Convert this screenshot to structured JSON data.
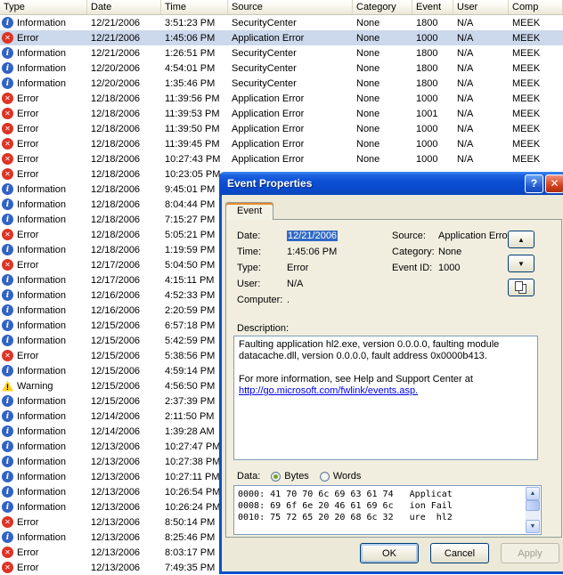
{
  "list": {
    "columns": [
      "Type",
      "Date",
      "Time",
      "Source",
      "Category",
      "Event",
      "User",
      "Comp"
    ],
    "rows": [
      {
        "type": "Information",
        "date": "12/21/2006",
        "time": "3:51:23 PM",
        "source": "SecurityCenter",
        "category": "None",
        "event": "1800",
        "user": "N/A",
        "computer": "MEEK",
        "selected": false
      },
      {
        "type": "Error",
        "date": "12/21/2006",
        "time": "1:45:06 PM",
        "source": "Application Error",
        "category": "None",
        "event": "1000",
        "user": "N/A",
        "computer": "MEEK",
        "selected": true
      },
      {
        "type": "Information",
        "date": "12/21/2006",
        "time": "1:26:51 PM",
        "source": "SecurityCenter",
        "category": "None",
        "event": "1800",
        "user": "N/A",
        "computer": "MEEK",
        "selected": false
      },
      {
        "type": "Information",
        "date": "12/20/2006",
        "time": "4:54:01 PM",
        "source": "SecurityCenter",
        "category": "None",
        "event": "1800",
        "user": "N/A",
        "computer": "MEEK",
        "selected": false
      },
      {
        "type": "Information",
        "date": "12/20/2006",
        "time": "1:35:46 PM",
        "source": "SecurityCenter",
        "category": "None",
        "event": "1800",
        "user": "N/A",
        "computer": "MEEK",
        "selected": false
      },
      {
        "type": "Error",
        "date": "12/18/2006",
        "time": "11:39:56 PM",
        "source": "Application Error",
        "category": "None",
        "event": "1000",
        "user": "N/A",
        "computer": "MEEK",
        "selected": false
      },
      {
        "type": "Error",
        "date": "12/18/2006",
        "time": "11:39:53 PM",
        "source": "Application Error",
        "category": "None",
        "event": "1001",
        "user": "N/A",
        "computer": "MEEK",
        "selected": false
      },
      {
        "type": "Error",
        "date": "12/18/2006",
        "time": "11:39:50 PM",
        "source": "Application Error",
        "category": "None",
        "event": "1000",
        "user": "N/A",
        "computer": "MEEK",
        "selected": false
      },
      {
        "type": "Error",
        "date": "12/18/2006",
        "time": "11:39:45 PM",
        "source": "Application Error",
        "category": "None",
        "event": "1000",
        "user": "N/A",
        "computer": "MEEK",
        "selected": false
      },
      {
        "type": "Error",
        "date": "12/18/2006",
        "time": "10:27:43 PM",
        "source": "Application Error",
        "category": "None",
        "event": "1000",
        "user": "N/A",
        "computer": "MEEK",
        "selected": false
      },
      {
        "type": "Error",
        "date": "12/18/2006",
        "time": "10:23:05 PM",
        "source": "",
        "category": "",
        "event": "",
        "user": "",
        "computer": "",
        "selected": false
      },
      {
        "type": "Information",
        "date": "12/18/2006",
        "time": "9:45:01 PM",
        "source": "",
        "category": "",
        "event": "",
        "user": "",
        "computer": "",
        "selected": false
      },
      {
        "type": "Information",
        "date": "12/18/2006",
        "time": "8:04:44 PM",
        "source": "",
        "category": "",
        "event": "",
        "user": "",
        "computer": "",
        "selected": false
      },
      {
        "type": "Information",
        "date": "12/18/2006",
        "time": "7:15:27 PM",
        "source": "",
        "category": "",
        "event": "",
        "user": "",
        "computer": "",
        "selected": false
      },
      {
        "type": "Error",
        "date": "12/18/2006",
        "time": "5:05:21 PM",
        "source": "",
        "category": "",
        "event": "",
        "user": "",
        "computer": "",
        "selected": false
      },
      {
        "type": "Information",
        "date": "12/18/2006",
        "time": "1:19:59 PM",
        "source": "",
        "category": "",
        "event": "",
        "user": "",
        "computer": "",
        "selected": false
      },
      {
        "type": "Error",
        "date": "12/17/2006",
        "time": "5:04:50 PM",
        "source": "",
        "category": "",
        "event": "",
        "user": "",
        "computer": "",
        "selected": false
      },
      {
        "type": "Information",
        "date": "12/17/2006",
        "time": "4:15:11 PM",
        "source": "",
        "category": "",
        "event": "",
        "user": "",
        "computer": "",
        "selected": false
      },
      {
        "type": "Information",
        "date": "12/16/2006",
        "time": "4:52:33 PM",
        "source": "",
        "category": "",
        "event": "",
        "user": "",
        "computer": "",
        "selected": false
      },
      {
        "type": "Information",
        "date": "12/16/2006",
        "time": "2:20:59 PM",
        "source": "",
        "category": "",
        "event": "",
        "user": "",
        "computer": "",
        "selected": false
      },
      {
        "type": "Information",
        "date": "12/15/2006",
        "time": "6:57:18 PM",
        "source": "",
        "category": "",
        "event": "",
        "user": "",
        "computer": "",
        "selected": false
      },
      {
        "type": "Information",
        "date": "12/15/2006",
        "time": "5:42:59 PM",
        "source": "",
        "category": "",
        "event": "",
        "user": "",
        "computer": "",
        "selected": false
      },
      {
        "type": "Error",
        "date": "12/15/2006",
        "time": "5:38:56 PM",
        "source": "",
        "category": "",
        "event": "",
        "user": "",
        "computer": "",
        "selected": false
      },
      {
        "type": "Information",
        "date": "12/15/2006",
        "time": "4:59:14 PM",
        "source": "",
        "category": "",
        "event": "",
        "user": "",
        "computer": "",
        "selected": false
      },
      {
        "type": "Warning",
        "date": "12/15/2006",
        "time": "4:56:50 PM",
        "source": "",
        "category": "",
        "event": "",
        "user": "",
        "computer": "",
        "selected": false
      },
      {
        "type": "Information",
        "date": "12/15/2006",
        "time": "2:37:39 PM",
        "source": "",
        "category": "",
        "event": "",
        "user": "",
        "computer": "",
        "selected": false
      },
      {
        "type": "Information",
        "date": "12/14/2006",
        "time": "2:11:50 PM",
        "source": "",
        "category": "",
        "event": "",
        "user": "",
        "computer": "",
        "selected": false
      },
      {
        "type": "Information",
        "date": "12/14/2006",
        "time": "1:39:28 AM",
        "source": "",
        "category": "",
        "event": "",
        "user": "",
        "computer": "",
        "selected": false
      },
      {
        "type": "Information",
        "date": "12/13/2006",
        "time": "10:27:47 PM",
        "source": "",
        "category": "",
        "event": "",
        "user": "",
        "computer": "",
        "selected": false
      },
      {
        "type": "Information",
        "date": "12/13/2006",
        "time": "10:27:38 PM",
        "source": "",
        "category": "",
        "event": "",
        "user": "",
        "computer": "",
        "selected": false
      },
      {
        "type": "Information",
        "date": "12/13/2006",
        "time": "10:27:11 PM",
        "source": "",
        "category": "",
        "event": "",
        "user": "",
        "computer": "",
        "selected": false
      },
      {
        "type": "Information",
        "date": "12/13/2006",
        "time": "10:26:54 PM",
        "source": "",
        "category": "",
        "event": "",
        "user": "",
        "computer": "",
        "selected": false
      },
      {
        "type": "Information",
        "date": "12/13/2006",
        "time": "10:26:24 PM",
        "source": "",
        "category": "",
        "event": "",
        "user": "",
        "computer": "",
        "selected": false
      },
      {
        "type": "Error",
        "date": "12/13/2006",
        "time": "8:50:14 PM",
        "source": "",
        "category": "",
        "event": "",
        "user": "",
        "computer": "",
        "selected": false
      },
      {
        "type": "Information",
        "date": "12/13/2006",
        "time": "8:25:46 PM",
        "source": "",
        "category": "",
        "event": "",
        "user": "",
        "computer": "",
        "selected": false
      },
      {
        "type": "Error",
        "date": "12/13/2006",
        "time": "8:03:17 PM",
        "source": "",
        "category": "",
        "event": "",
        "user": "",
        "computer": "",
        "selected": false
      },
      {
        "type": "Error",
        "date": "12/13/2006",
        "time": "7:49:35 PM",
        "source": "",
        "category": "",
        "event": "",
        "user": "",
        "computer": "",
        "selected": false
      }
    ]
  },
  "dialog": {
    "title": "Event Properties",
    "help_glyph": "?",
    "close_glyph": "✕",
    "tab": "Event",
    "fields": {
      "date_label": "Date:",
      "date": "12/21/2006",
      "source_label": "Source:",
      "source": "Application Error",
      "time_label": "Time:",
      "time": "1:45:06 PM",
      "category_label": "Category:",
      "category": "None",
      "type_label": "Type:",
      "type": "Error",
      "event_id_label": "Event ID:",
      "event_id": "1000",
      "user_label": "User:",
      "user": "N/A",
      "computer_label": "Computer:",
      "computer": "."
    },
    "description_label": "Description:",
    "description_line1": "Faulting application hl2.exe, version 0.0.0.0, faulting module datacache.dll, version 0.0.0.0, fault address 0x0000b413.",
    "description_line2": "For more information, see Help and Support Center at",
    "description_link": "http://go.microsoft.com/fwlink/events.asp.",
    "data_label": "Data:",
    "bytes_label": "Bytes",
    "words_label": "Words",
    "hex_lines": [
      "0000: 41 70 70 6c 69 63 61 74   Applicat",
      "0008: 69 6f 6e 20 46 61 69 6c   ion Fail",
      "0010: 75 72 65 20 20 68 6c 32   ure  hl2"
    ],
    "ok_label": "OK",
    "cancel_label": "Cancel",
    "apply_label": "Apply"
  },
  "colors": {
    "titlebar_blue": "#0d50d4",
    "dialog_face": "#ece9d8",
    "selection_blue": "#316ac5",
    "inactive_selection": "#ccd8ec",
    "error_red": "#dd3425",
    "info_blue": "#3163c5",
    "warning_yellow": "#fed31b",
    "link_blue": "#0000ee"
  }
}
